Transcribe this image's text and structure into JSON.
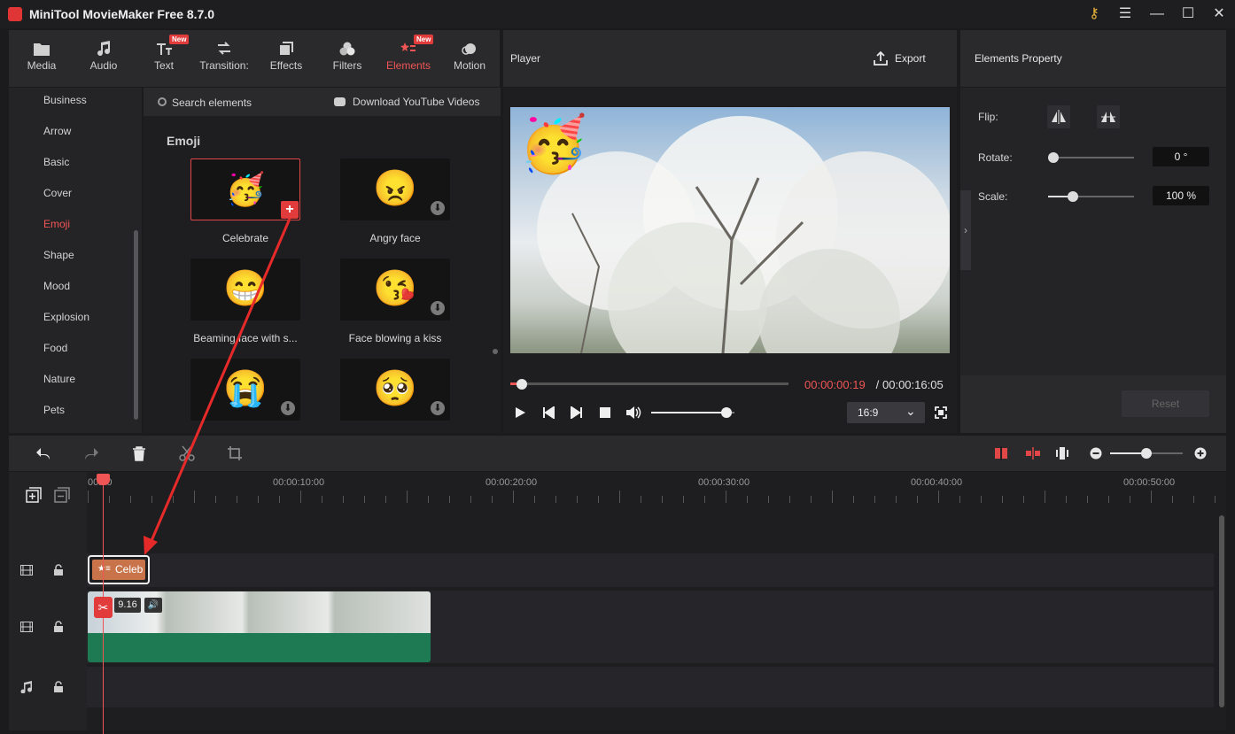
{
  "app": {
    "title": "MiniTool MovieMaker Free 8.7.0"
  },
  "toolbar_tabs": [
    {
      "label": "Media",
      "icon": "folder-icon"
    },
    {
      "label": "Audio",
      "icon": "music-icon"
    },
    {
      "label": "Text",
      "icon": "text-icon",
      "badge": "New"
    },
    {
      "label": "Transition:",
      "icon": "transition-icon"
    },
    {
      "label": "Effects",
      "icon": "effects-icon"
    },
    {
      "label": "Filters",
      "icon": "filters-icon"
    },
    {
      "label": "Elements",
      "icon": "elements-icon",
      "badge": "New",
      "active": true
    },
    {
      "label": "Motion",
      "icon": "motion-icon"
    }
  ],
  "sidebar": {
    "categories": [
      "Business",
      "Arrow",
      "Basic",
      "Cover",
      "Emoji",
      "Shape",
      "Mood",
      "Explosion",
      "Food",
      "Nature",
      "Pets"
    ],
    "active": "Emoji"
  },
  "library": {
    "search_label": "Search elements",
    "download_label": "Download YouTube Videos",
    "section_title": "Emoji",
    "items": [
      {
        "label": "Celebrate",
        "emoji": "🥳"
      },
      {
        "label": "Angry face",
        "emoji": "😠"
      },
      {
        "label": "Beaming face with s...",
        "emoji": "😁"
      },
      {
        "label": "Face blowing a kiss",
        "emoji": "😘"
      },
      {
        "label": "",
        "emoji": "😭"
      },
      {
        "label": "",
        "emoji": "🥺"
      }
    ]
  },
  "player": {
    "title": "Player",
    "export_label": "Export",
    "current_time": "00:00:00:19",
    "separator": " / ",
    "total_time": "00:00:16:05",
    "aspect_ratio": "16:9",
    "overlay_emoji": "🥳",
    "progress": 0.04,
    "volume": 0.9
  },
  "properties": {
    "title": "Elements Property",
    "flip_label": "Flip:",
    "rotate_label": "Rotate:",
    "rotate_value": "0 °",
    "scale_label": "Scale:",
    "scale_value": "100 %",
    "reset_label": "Reset"
  },
  "timeline": {
    "timecodes": [
      "00:00",
      "00:00:10:00",
      "00:00:20:00",
      "00:00:30:00",
      "00:00:40:00",
      "00:00:50:00"
    ],
    "element_clip_label": "Celeb",
    "video_clip_speed": "9.16",
    "zoom": 0.5
  },
  "colors": {
    "accent": "#f05555",
    "video_clip": "#1e7a52",
    "element_clip": "#c9734a"
  }
}
